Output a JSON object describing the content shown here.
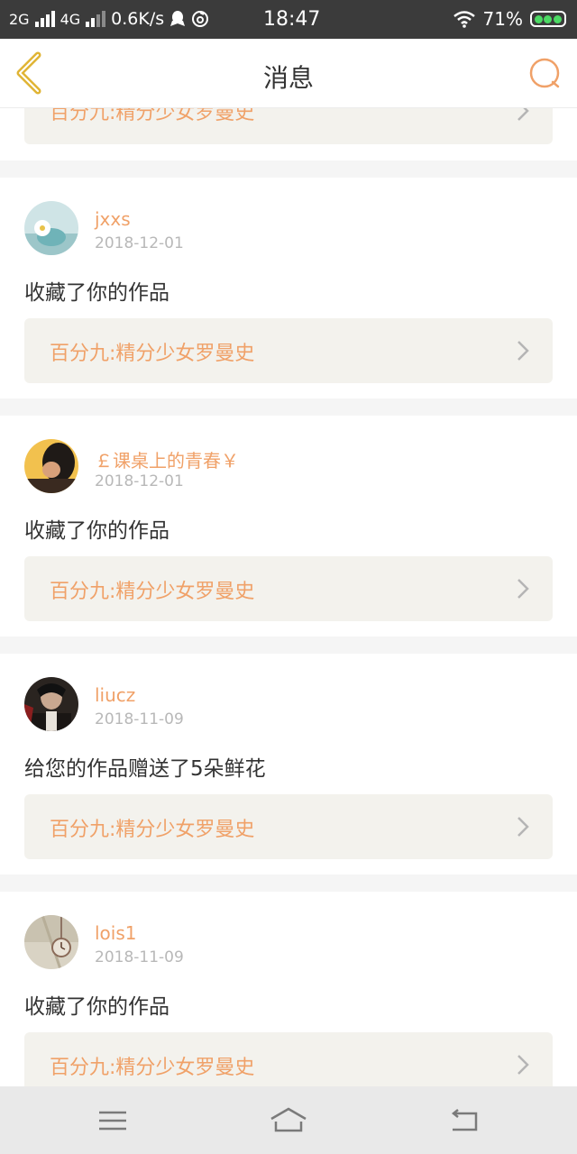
{
  "status_bar": {
    "net1": "2G",
    "net2": "4G",
    "speed": "0.6K/s",
    "time": "18:47",
    "battery": "71%"
  },
  "header": {
    "title": "消息"
  },
  "messages": [
    {
      "work_title": "百分九:精分少女罗曼史"
    },
    {
      "username": "jxxs",
      "date": "2018-12-01",
      "action": "收藏了你的作品",
      "work_title": "百分九:精分少女罗曼史"
    },
    {
      "username": "￡课桌上的青春￥",
      "date": "2018-12-01",
      "action": "收藏了你的作品",
      "work_title": "百分九:精分少女罗曼史"
    },
    {
      "username": "liucz",
      "date": "2018-11-09",
      "action": "给您的作品赠送了5朵鲜花",
      "work_title": "百分九:精分少女罗曼史"
    },
    {
      "username": "lois1",
      "date": "2018-11-09",
      "action": "收藏了你的作品",
      "work_title": "百分九:精分少女罗曼史"
    }
  ],
  "colors": {
    "accent": "#f0a168",
    "back_arrow": "#e0b434",
    "work_box_bg": "#f3f2ed",
    "status_bar_bg": "#3b3b3b"
  },
  "icons": {
    "back": "back-arrow-icon",
    "search": "search-icon",
    "chevron": "chevron-right-icon",
    "menu": "menu-icon",
    "home": "home-icon",
    "return": "return-icon"
  }
}
